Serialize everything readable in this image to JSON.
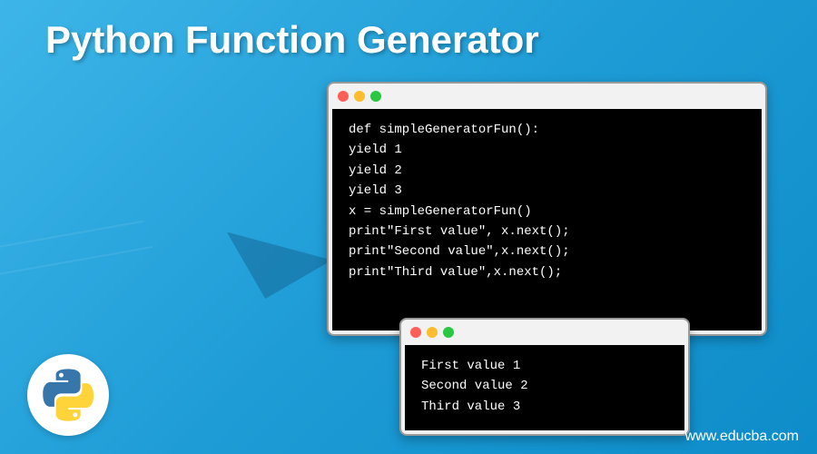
{
  "title": "Python Function Generator",
  "code_window": {
    "lines": [
      "def simpleGeneratorFun():",
      "yield 1",
      "yield 2",
      "yield 3",
      "x = simpleGeneratorFun()",
      "print\"First value\", x.next();",
      "print\"Second value\",x.next();",
      "print\"Third value\",x.next();"
    ]
  },
  "output_window": {
    "lines": [
      "First value 1",
      "Second value 2",
      "Third value 3"
    ]
  },
  "logo": {
    "name": "python-logo"
  },
  "watermark": "www.educba.com"
}
